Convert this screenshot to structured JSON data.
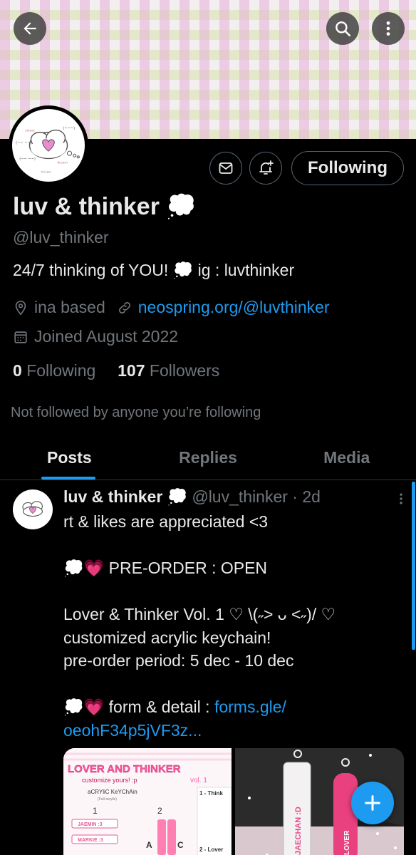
{
  "header": {
    "back_icon": "arrow-left-icon",
    "search_icon": "search-icon",
    "more_icon": "more-vertical-icon"
  },
  "profile": {
    "display_name": "luv & thinker 💭",
    "handle": "@luv_thinker",
    "bio": "24/7 thinking of YOU! 💭 ig : luvthinker",
    "location": "ina based",
    "website": "neospring.org/@luvthinker",
    "joined": "Joined August 2022",
    "following_count": "0",
    "following_label": "Following",
    "followers_count": "107",
    "followers_label": "Followers",
    "not_followed": "Not followed by anyone you’re following",
    "avatar_texts": [
      "sweet",
      "dream",
      "(~~~)",
      "(~~ ~~)",
      "(~~ ~~)",
      "thinker"
    ]
  },
  "actions": {
    "message_icon": "mail-icon",
    "notify_icon": "bell-plus-icon",
    "following_button": "Following"
  },
  "tabs": [
    "Posts",
    "Replies",
    "Media"
  ],
  "tweet": {
    "name": "luv & thinker 💭",
    "handle_time": "@luv_thinker · 2d",
    "lines": [
      "rt & likes are appreciated <3",
      "",
      "💭💗 PRE-ORDER : OPEN",
      "",
      "Lover & Thinker Vol. 1 ♡ \\(˶> ᴗ <˶)/ ♡",
      "customized acrylic keychain!",
      "pre-order period: 5 dec - 10 dec",
      ""
    ],
    "form_prefix": "💭💗 form & detail : ",
    "form_link_1": "forms.gle/",
    "form_link_2": "oeohF34p5jVF3z...",
    "media1": {
      "title": "LOVER AND THINKER",
      "subtitle": "customize yours! :p",
      "vol": "vol. 1",
      "section": "aCRYliC KeYChAin",
      "section_sub": "(Full acrylic)",
      "side_1": "1 - Think",
      "side_2": "2 - Lover",
      "num_1": "1",
      "num_2": "2",
      "names": [
        "JAEMIN :3",
        "MARKIE :3"
      ],
      "letters": [
        "A",
        "C"
      ]
    },
    "media2": {
      "tag_1": "JAECHAN :D",
      "tag_2": "LOVER"
    }
  },
  "fab_icon": "plus-icon",
  "colors": {
    "accent": "#1d9bf0",
    "muted": "#71767b",
    "text": "#e7e9ea",
    "pink": "#e84a8b"
  }
}
